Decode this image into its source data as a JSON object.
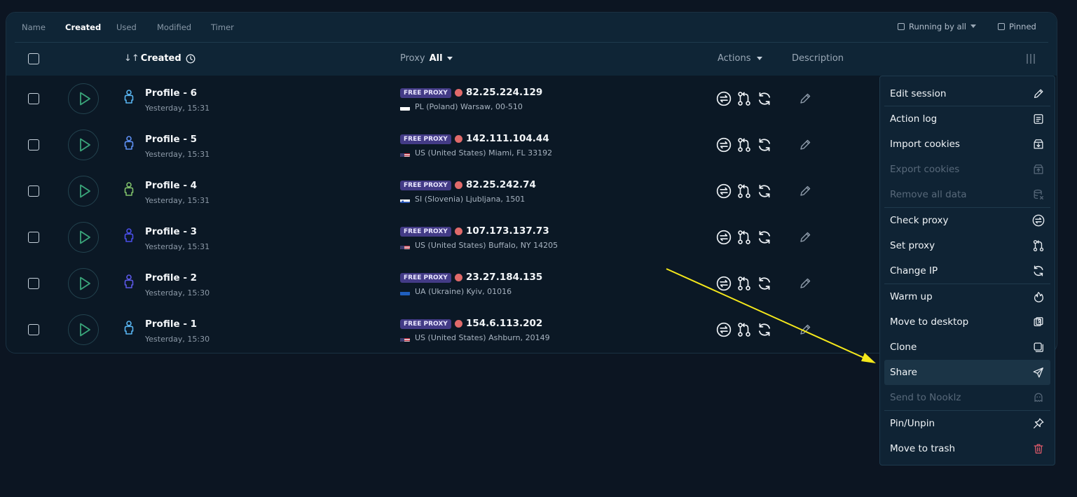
{
  "tabs": [
    {
      "label": "Name",
      "active": false
    },
    {
      "label": "Created",
      "active": true
    },
    {
      "label": "Used",
      "active": false
    },
    {
      "label": "Modified",
      "active": false
    },
    {
      "label": "Timer",
      "active": false
    }
  ],
  "filters": {
    "running_by_all": "Running by all",
    "pinned": "Pinned"
  },
  "columns": {
    "created": "Created",
    "proxy": "Proxy",
    "proxy_filter": "All",
    "actions": "Actions",
    "description": "Description"
  },
  "profiles": [
    {
      "name": "Profile - 6",
      "date": "Yesterday, 15:31",
      "badge": "FREE PROXY",
      "ip": "82.25.224.129",
      "country": "PL",
      "location": "PL (Poland) Warsaw, 00-510",
      "icon_color": "#58b4f0"
    },
    {
      "name": "Profile - 5",
      "date": "Yesterday, 15:31",
      "badge": "FREE PROXY",
      "ip": "142.111.104.44",
      "country": "US",
      "location": "US (United States) Miami, FL 33192",
      "icon_color": "#5d8ff2"
    },
    {
      "name": "Profile - 4",
      "date": "Yesterday, 15:31",
      "badge": "FREE PROXY",
      "ip": "82.25.242.74",
      "country": "SI",
      "location": "SI (Slovenia) Ljubljana, 1501",
      "icon_color": "#7fbf6a"
    },
    {
      "name": "Profile - 3",
      "date": "Yesterday, 15:31",
      "badge": "FREE PROXY",
      "ip": "107.173.137.73",
      "country": "US",
      "location": "US (United States) Buffalo, NY 14205",
      "icon_color": "#4a4ee8"
    },
    {
      "name": "Profile - 2",
      "date": "Yesterday, 15:30",
      "badge": "FREE PROXY",
      "ip": "23.27.184.135",
      "country": "UA",
      "location": "UA (Ukraine) Kyiv, 01016",
      "icon_color": "#5b58e6"
    },
    {
      "name": "Profile - 1",
      "date": "Yesterday, 15:30",
      "badge": "FREE PROXY",
      "ip": "154.6.113.202",
      "country": "US",
      "location": "US (United States) Ashburn, 20149",
      "icon_color": "#58b4f0"
    }
  ],
  "menu": [
    {
      "label": "Edit session",
      "icon": "pencil-icon",
      "disabled": false
    },
    {
      "label": "Action log",
      "icon": "log-icon",
      "disabled": false
    },
    {
      "label": "Import cookies",
      "icon": "import-icon",
      "disabled": false
    },
    {
      "label": "Export cookies",
      "icon": "export-icon",
      "disabled": true
    },
    {
      "label": "Remove all data",
      "icon": "database-remove-icon",
      "disabled": true
    },
    {
      "label": "Check proxy",
      "icon": "swap-icon",
      "disabled": false
    },
    {
      "label": "Set proxy",
      "icon": "git-branch-icon",
      "disabled": false
    },
    {
      "label": "Change IP",
      "icon": "refresh-icon",
      "disabled": false
    },
    {
      "label": "Warm up",
      "icon": "flame-icon",
      "disabled": false
    },
    {
      "label": "Move to desktop",
      "icon": "desktop-icon",
      "disabled": false
    },
    {
      "label": "Clone",
      "icon": "clone-icon",
      "disabled": false
    },
    {
      "label": "Share",
      "icon": "send-icon",
      "disabled": false,
      "highlight": true
    },
    {
      "label": "Send to Nooklz",
      "icon": "ghost-icon",
      "disabled": true
    },
    {
      "label": "Pin/Unpin",
      "icon": "pin-icon",
      "disabled": false
    },
    {
      "label": "Move to trash",
      "icon": "trash-icon",
      "disabled": false,
      "color": "#e05a6a"
    }
  ],
  "colors": {
    "accent_play": "#3aa57a",
    "badge": "#433b86",
    "status_dot": "#e06a6a",
    "arrow": "#f5e81b"
  }
}
